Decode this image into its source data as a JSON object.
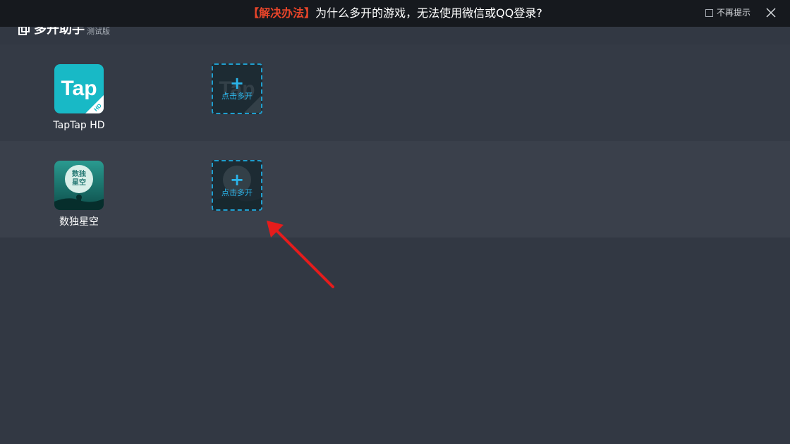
{
  "notice": {
    "highlight": "【解决办法】",
    "message": "为什么多开的游戏，无法使用微信或QQ登录?",
    "no_remind_label": "不再提示",
    "no_remind_checked": false,
    "close_icon": "close-icon"
  },
  "app": {
    "title": "多开助手",
    "edition": "测试版",
    "logo_icon": "app-logo-icon"
  },
  "apps": [
    {
      "name": "TapTap HD",
      "icon": "taptap-hd-icon",
      "icon_text": "Tap",
      "icon_badge": "HD",
      "icon_color": "#18b9c6",
      "clone_label": "点击多开",
      "clone_plus": "+"
    },
    {
      "name": "数独星空",
      "icon": "sudoku-starry-icon",
      "icon_text_top": "数独",
      "icon_text_bottom": "星空",
      "icon_color": "#1f7f7a",
      "clone_label": "点击多开",
      "clone_plus": "+"
    }
  ],
  "annotation": {
    "arrow_color": "#e51c1c",
    "arrow_icon": "red-arrow-annotation"
  }
}
